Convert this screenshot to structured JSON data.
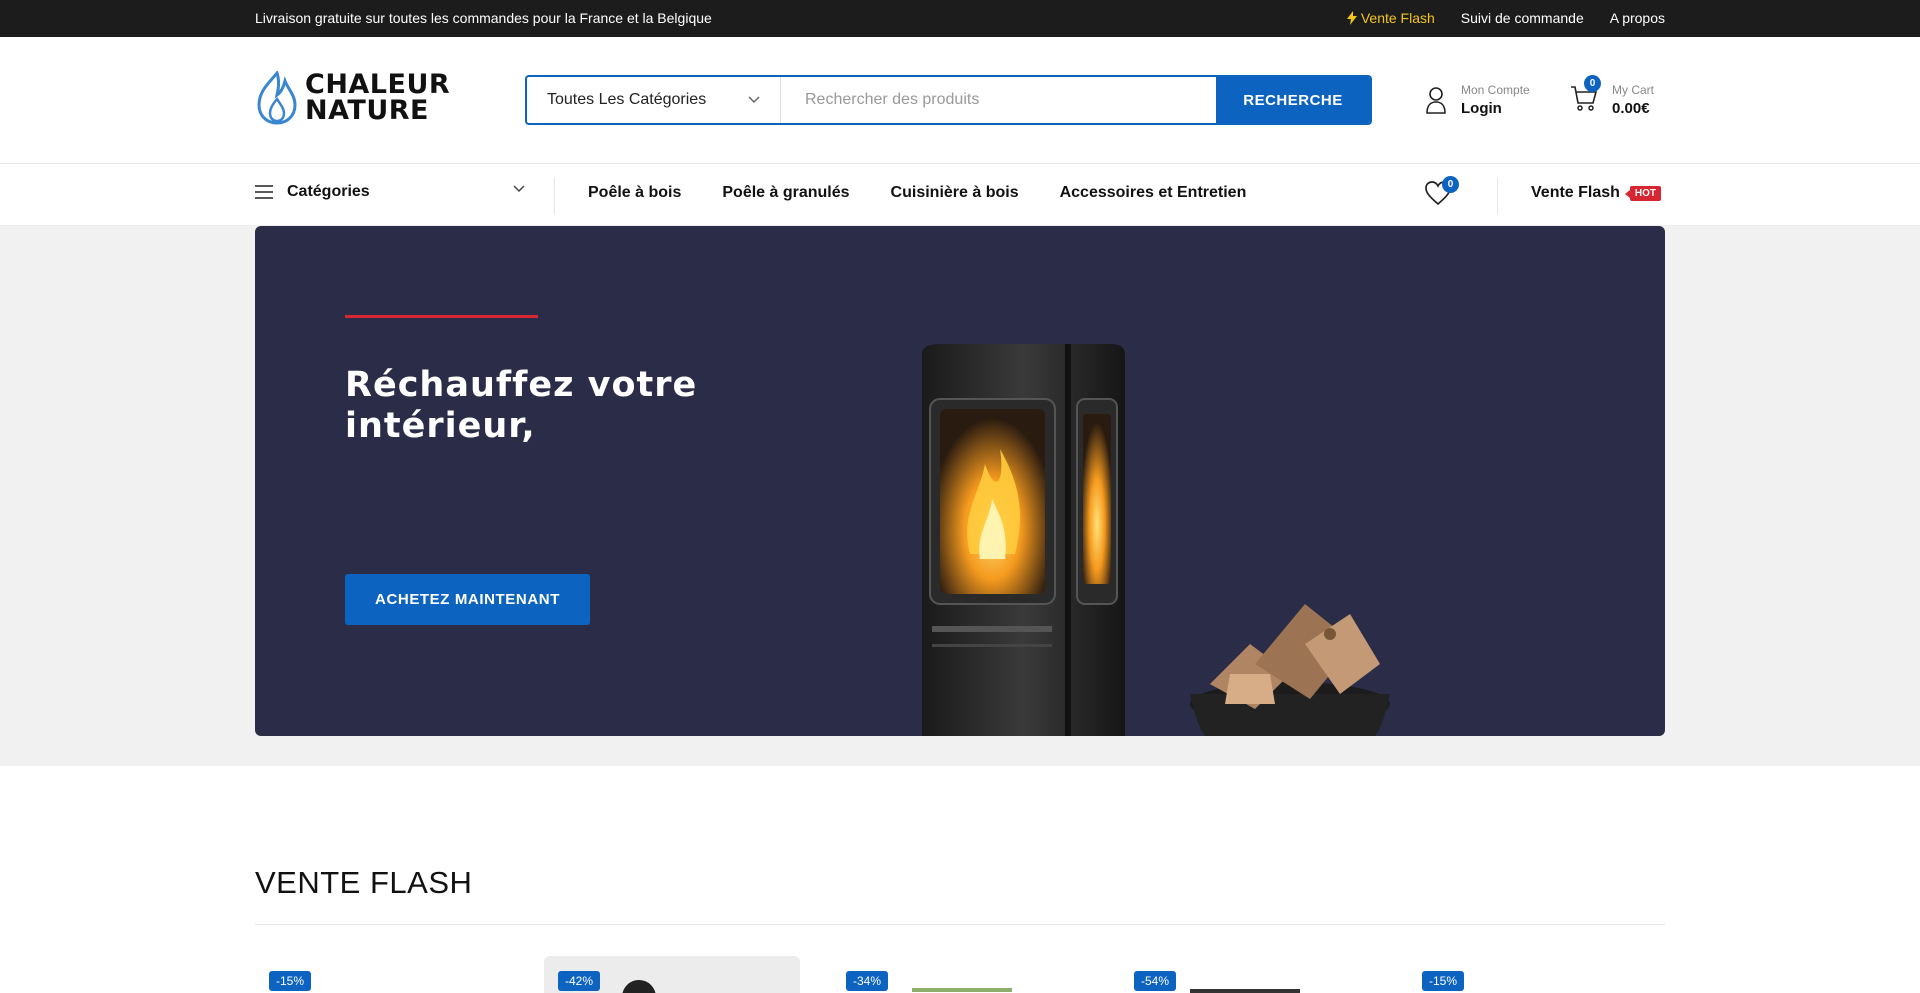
{
  "topbar": {
    "promo": "Livraison gratuite sur toutes les commandes pour la France et la Belgique",
    "flash_link": "Vente Flash",
    "tracking_link": "Suivi de commande",
    "about_link": "A propos"
  },
  "brand": {
    "line1": "CHALEUR",
    "line2": "NATURE"
  },
  "search": {
    "category": "Toutes Les Catégories",
    "placeholder": "Rechercher des produits",
    "button": "RECHERCHE"
  },
  "account": {
    "caption": "Mon Compte",
    "label": "Login"
  },
  "cart": {
    "count": "0",
    "caption": "My Cart",
    "total": "0.00€"
  },
  "nav": {
    "categories": "Catégories",
    "items": [
      "Poêle à bois",
      "Poêle à granulés",
      "Cuisinière à bois",
      "Accessoires et Entretien"
    ],
    "wishlist_count": "0",
    "flash": "Vente Flash",
    "hot": "HOT"
  },
  "hero": {
    "title": "Réchauffez votre intérieur,",
    "cta": "ACHETEZ MAINTENANT"
  },
  "flash_sale": {
    "title": "VENTE FLASH",
    "discounts": [
      "-15%",
      "-42%",
      "-34%",
      "-54%",
      "-15%"
    ]
  },
  "colors": {
    "accent": "#0d63c0",
    "hero_bg": "#2b2d48",
    "hot": "#d62631",
    "flash": "#f5c518"
  }
}
